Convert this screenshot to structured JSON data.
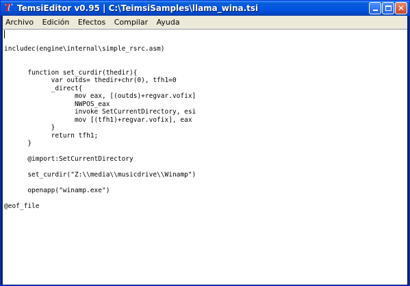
{
  "window": {
    "title": "TemsiEditor v0.95 | C:\\TeimsiSamples\\llama_wina.tsi",
    "icon": "app-logo-icon"
  },
  "titlebar_buttons": {
    "minimize_icon": "minimize-icon",
    "maximize_icon": "maximize-icon",
    "close_label": "✕"
  },
  "menubar": {
    "items": [
      "Archivo",
      "Edición",
      "Efectos",
      "Compilar",
      "Ayuda"
    ]
  },
  "editor": {
    "lines": [
      "",
      "",
      "includec(engine\\internal\\simple_rsrc.asm)",
      "",
      "",
      "      function set_curdir(thedir){",
      "            var outds= thedir+chr(0), tfh1=0",
      "            _direct{",
      "                  mov eax, [(outds)+regvar.vofix]",
      "                  NWPOS_eax",
      "                  invoke SetCurrentDirectory, esi",
      "                  mov [(tfh1)+regvar.vofix], eax",
      "            }",
      "            return tfh1;",
      "      }",
      "",
      "      @import:SetCurrentDirectory",
      "",
      "      set_curdir(\"Z:\\\\media\\\\musicdrive\\\\Winamp\")",
      "",
      "      openapp(\"winamp.exe\")",
      "",
      "@eof_file"
    ]
  },
  "colors": {
    "titlebar": "#0254e2",
    "menubar": "#ece9d8",
    "editor_bg": "#ffffff",
    "close_button": "#c8452a"
  }
}
